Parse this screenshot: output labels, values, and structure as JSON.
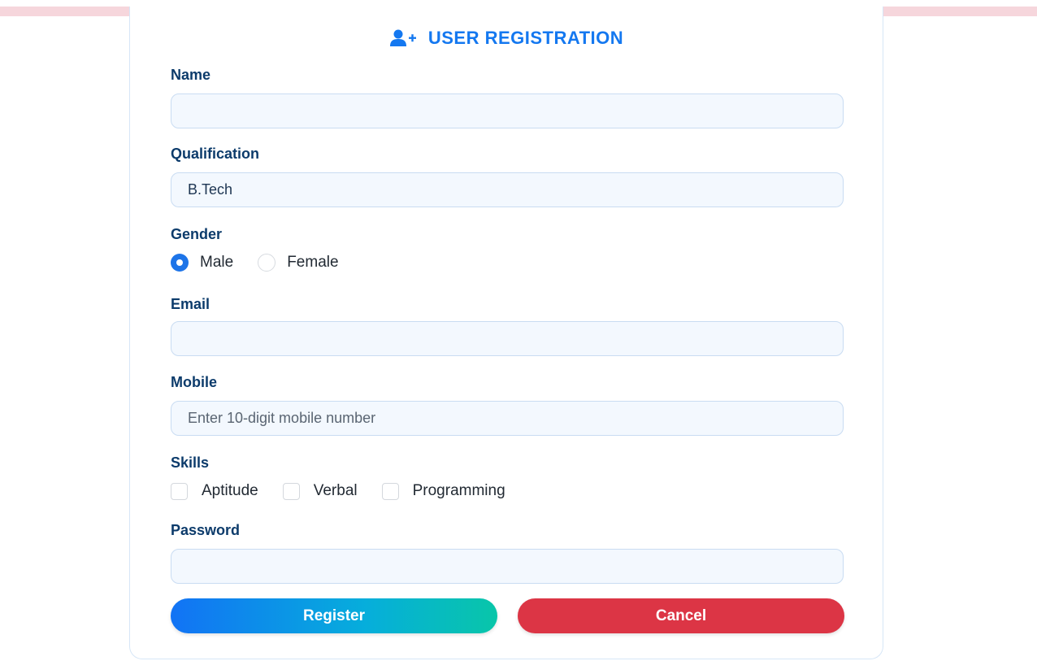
{
  "form": {
    "title": "USER REGISTRATION",
    "title_icon": "user-plus-icon",
    "fields": {
      "name": {
        "label": "Name",
        "value": "",
        "placeholder": ""
      },
      "qualification": {
        "label": "Qualification",
        "value": "B.Tech",
        "placeholder": ""
      },
      "gender": {
        "label": "Gender",
        "options": [
          "Male",
          "Female"
        ],
        "selected": "Male"
      },
      "email": {
        "label": "Email",
        "value": "",
        "placeholder": ""
      },
      "mobile": {
        "label": "Mobile",
        "value": "",
        "placeholder": "Enter 10-digit mobile number"
      },
      "skills": {
        "label": "Skills",
        "options": [
          "Aptitude",
          "Verbal",
          "Programming"
        ],
        "checked": []
      },
      "password": {
        "label": "Password",
        "value": "",
        "placeholder": ""
      }
    },
    "buttons": {
      "register": "Register",
      "cancel": "Cancel"
    }
  },
  "colors": {
    "accent": "#1478f0",
    "label": "#0c3b6b",
    "cancel": "#dc3545",
    "register_gradient_start": "#1273f5",
    "register_gradient_end": "#08c6a9"
  }
}
